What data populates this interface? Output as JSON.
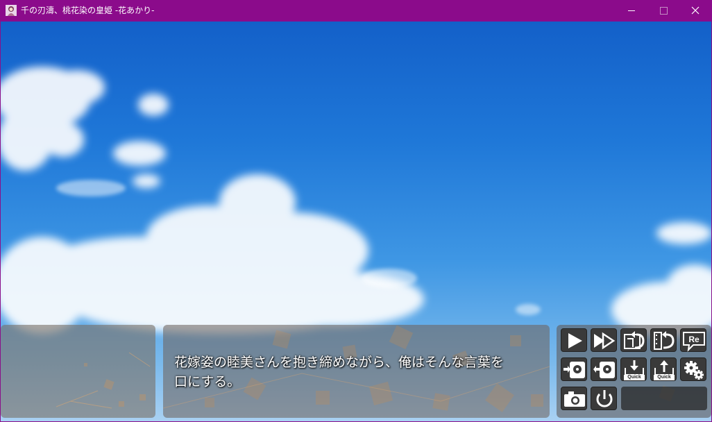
{
  "window": {
    "title": "千の刃濤、桃花染の皇姫 -花あかり-",
    "icon": "app-character-icon",
    "controls": [
      "minimize-icon",
      "maximize-icon",
      "close-icon"
    ]
  },
  "scene": {
    "background": "blue-sky-with-clouds"
  },
  "name_box": {
    "speaker": ""
  },
  "message_box": {
    "text": "花嫁姿の睦美さんを抱き締めながら、俺はそんな言葉を\n口にする。"
  },
  "menu": {
    "buttons": [
      {
        "name": "auto-play-button",
        "icon": "play-icon"
      },
      {
        "name": "skip-button",
        "icon": "fast-forward-icon"
      },
      {
        "name": "back-log-button",
        "icon": "backlog-icon"
      },
      {
        "name": "scene-jump-button",
        "icon": "film-return-icon"
      },
      {
        "name": "replay-voice-button",
        "icon": "replay-voice-icon",
        "label": "Re"
      },
      {
        "name": "save-button",
        "icon": "disk-save-icon"
      },
      {
        "name": "load-button",
        "icon": "disk-load-icon"
      },
      {
        "name": "quick-save-button",
        "icon": "quick-save-icon",
        "label": "Quick"
      },
      {
        "name": "quick-load-button",
        "icon": "quick-load-icon",
        "label": "Quick"
      },
      {
        "name": "config-button",
        "icon": "gears-icon"
      },
      {
        "name": "screenshot-button",
        "icon": "camera-icon"
      },
      {
        "name": "exit-button",
        "icon": "power-icon"
      }
    ]
  },
  "colors": {
    "titlebar": "#8b0b8b",
    "sky_top": "#1360c9",
    "sky_bottom": "#a9d1f3"
  }
}
